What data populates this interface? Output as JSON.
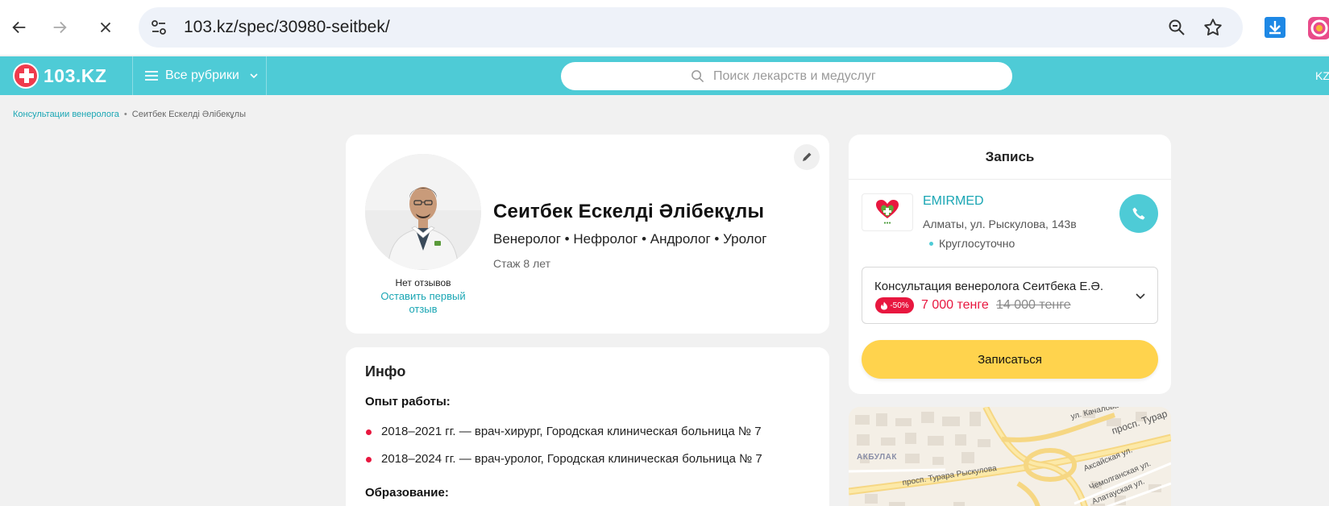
{
  "browser": {
    "url": "103.kz/spec/30980-seitbek/"
  },
  "header": {
    "logo_text": "103.KZ",
    "rubrics_label": "Все рубрики",
    "search_placeholder": "Поиск лекарств и медуслуг",
    "lang_label": "KZ"
  },
  "breadcrumb": {
    "parent": "Консультации венеролога",
    "separator": "•",
    "current": "Сеитбек Ескелді Әлібекұлы"
  },
  "profile": {
    "name": "Сеитбек Ескелді Әлібекұлы",
    "specialties": "Венеролог • Нефролог • Андролог • Уролог",
    "experience": "Стаж 8 лет",
    "no_reviews": "Нет отзывов",
    "first_review_link": "Оставить первый отзыв"
  },
  "info": {
    "title": "Инфо",
    "experience_title": "Опыт работы:",
    "experience_items": [
      "2018–2021 гг. — врач-хирург, Городская клиническая больница № 7",
      "2018–2024 гг. — врач-уролог, Городская клиническая больница № 7"
    ],
    "education_title": "Образование:"
  },
  "booking": {
    "title": "Запись",
    "clinic_name": "EMIRMED",
    "clinic_address": "Алматы, ул. Рыскулова, 143в",
    "clinic_hours": "Круглосуточно",
    "service_name": "Консультация венеролога Сеитбека Е.Ә.",
    "discount": "-50%",
    "price_new": "7 000 тенге",
    "price_old": "14 000 тенге",
    "book_button": "Записаться"
  },
  "map": {
    "labels": {
      "street1": "ул. Качалова",
      "street2": "просп. Турар",
      "district": "АКБУЛАК",
      "street3": "просп. Турара Рыскулова",
      "street4": "Аксайская ул.",
      "street5": "Чемолганская ул.",
      "street6": "Алатауская ул."
    }
  },
  "colors": {
    "brand_teal": "#4ecbd6",
    "brand_red": "#ef3b4d",
    "link": "#1aa6b4",
    "accent_red": "#e8173f",
    "button_yellow": "#ffd34d"
  }
}
